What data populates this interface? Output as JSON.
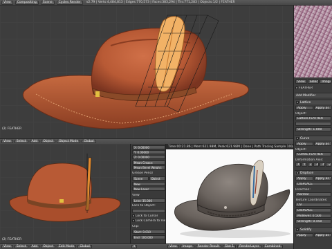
{
  "topbar": {
    "view": "View",
    "screen": "Compositing",
    "scene": "Scene",
    "engine": "Cycles Render",
    "stats": "v2.79 | Verts:4,484,813 | Edges:770,573 | Faces:383,294 | Tris:771,283 | Objects:1/2 | FEATHER"
  },
  "main_viewport": {
    "name_label": "(2) FEATHER",
    "header": {
      "view": "View",
      "select": "Select",
      "add": "Add",
      "object": "Object",
      "mode": "Object Mode",
      "shading": "Global"
    }
  },
  "right_panel": {
    "tabs": [
      "View",
      "Select",
      "Image"
    ],
    "breadcrumb": "FEATHER",
    "section_title": "Add Modifier",
    "modifiers": [
      {
        "name": "Lattice",
        "apply": "Apply",
        "apply_as": "Apply as Sh",
        "object_label": "Object:",
        "object": "Lattice.FEATHER",
        "vgroup": "",
        "strength_label": "Strength:",
        "strength": "1.000"
      },
      {
        "name": "Curve",
        "apply": "Apply",
        "apply_as": "Apply as Sh",
        "object_label": "Object:",
        "object": "CURVE.FEATHER",
        "deform_label": "Deformation Axis:",
        "axes": [
          "X",
          "Y",
          "Z",
          "-X",
          "-Y",
          "-Z"
        ]
      },
      {
        "name": "Displace",
        "apply": "Apply",
        "apply_as": "Apply as Sh",
        "texture": "DISPLACE",
        "direction_label": "Direction:",
        "direction": "Normal",
        "coords_label": "Texture Coordinates:",
        "coords": "UV",
        "uv_map": "DISPLACE",
        "midlevel_label": "Midlevel:",
        "midlevel": "0.500",
        "strength_label": "Strength:",
        "strength": "0.450"
      },
      {
        "name": "Solidify",
        "apply": "Apply",
        "apply_as": "Apply as Sh"
      }
    ]
  },
  "bl_viewport": {
    "name_label": "(2) FEATHER",
    "header": {
      "view": "View",
      "select": "Select",
      "add": "Add",
      "object": "Object",
      "mode": "Edit Mode",
      "shading": "Global"
    }
  },
  "tool_panel": {
    "x_label": "X:",
    "x": "0.00000",
    "y_label": "Y:",
    "y": "0.00000",
    "z_label": "Z:",
    "z": "0.00000",
    "mean_crease": "Mean Crease:",
    "mean_bevel": "Mean Bevel Weight:",
    "grease_pencil": "Grease Pencil",
    "scene": "Scene",
    "object": "Object",
    "new": "New",
    "new_layer": "New Layer",
    "view_section": "View",
    "lens_label": "Lens:",
    "lens": "35.000",
    "lock_object": "Lock to Object:",
    "lock_cursor": "Lock to Cursor",
    "lock_camera": "Lock Camera to View",
    "clip": "Clip:",
    "start_label": "Start:",
    "start": "0.010",
    "end_label": "End:",
    "end": "100.000"
  },
  "render_view": {
    "stats": "Time:00:21.86 | Mem:621.98M, Peak:621.98M | Done | Path Tracing Sample 100/100",
    "header": {
      "view": "View",
      "image": "Image",
      "render_result": "Render Result",
      "slot": "Slot 1",
      "layer": "RenderLayer",
      "pass": "Combined"
    }
  },
  "colors": {
    "hat_main": "#b85a35",
    "hat_dark": "#7a3420",
    "hat_light": "#d88050",
    "feather": "#e8a050",
    "accent": "#e39b3a"
  }
}
